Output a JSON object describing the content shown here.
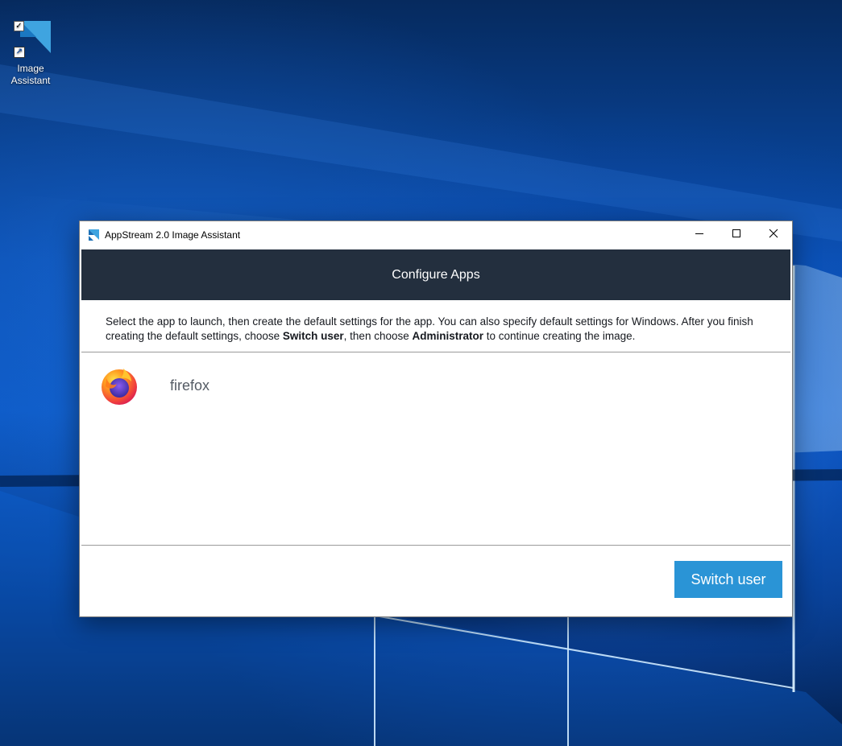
{
  "desktop": {
    "icons": [
      {
        "label": "Image Assistant",
        "line1": "Image",
        "line2": "Assistant"
      }
    ]
  },
  "window": {
    "title": "AppStream 2.0 Image Assistant",
    "controls": {
      "minimize": "minimize-icon",
      "maximize": "maximize-icon",
      "close": "close-icon"
    },
    "header": "Configure Apps",
    "instructions": {
      "part1": "Select the app to launch, then create the default settings for the app. You can also specify default settings for Windows. After you finish creating the default settings, choose ",
      "bold1": "Switch user",
      "part2": ", then choose ",
      "bold2": "Administrator",
      "part3": " to continue creating the image."
    },
    "apps": [
      {
        "name": "firefox",
        "icon": "firefox-icon"
      }
    ],
    "footer": {
      "switch_user_label": "Switch user"
    }
  },
  "colors": {
    "header_bg": "#232f3e",
    "button_bg": "#2a94d6",
    "app_name": "#545b64"
  }
}
